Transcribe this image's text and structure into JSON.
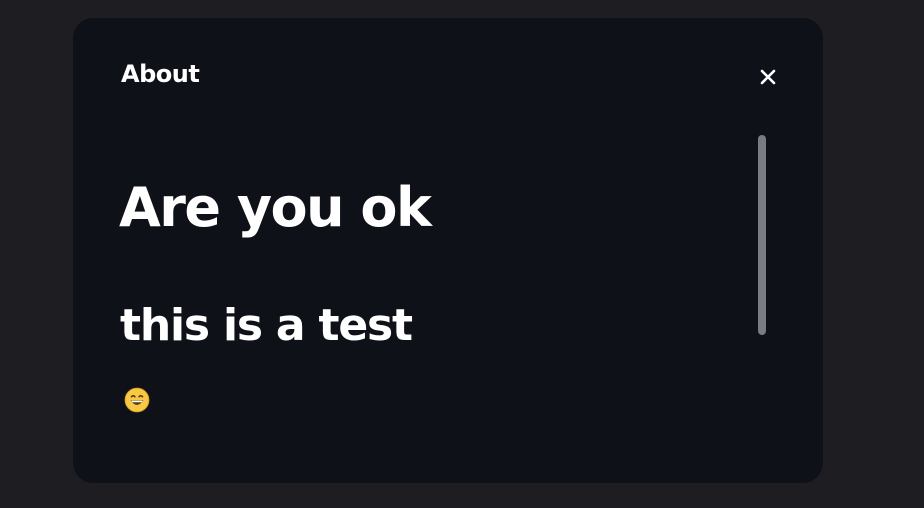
{
  "dialog": {
    "title": "About",
    "close_icon": "close-icon",
    "heading": "Are you ok",
    "subheading": "this is a test",
    "emoji": "😁",
    "emoji_icon": "grinning-face-icon"
  },
  "colors": {
    "page_background": "#1e1e22",
    "dialog_background": "#0f1118",
    "text": "#ffffff",
    "scrollbar": "#7b7b82"
  }
}
